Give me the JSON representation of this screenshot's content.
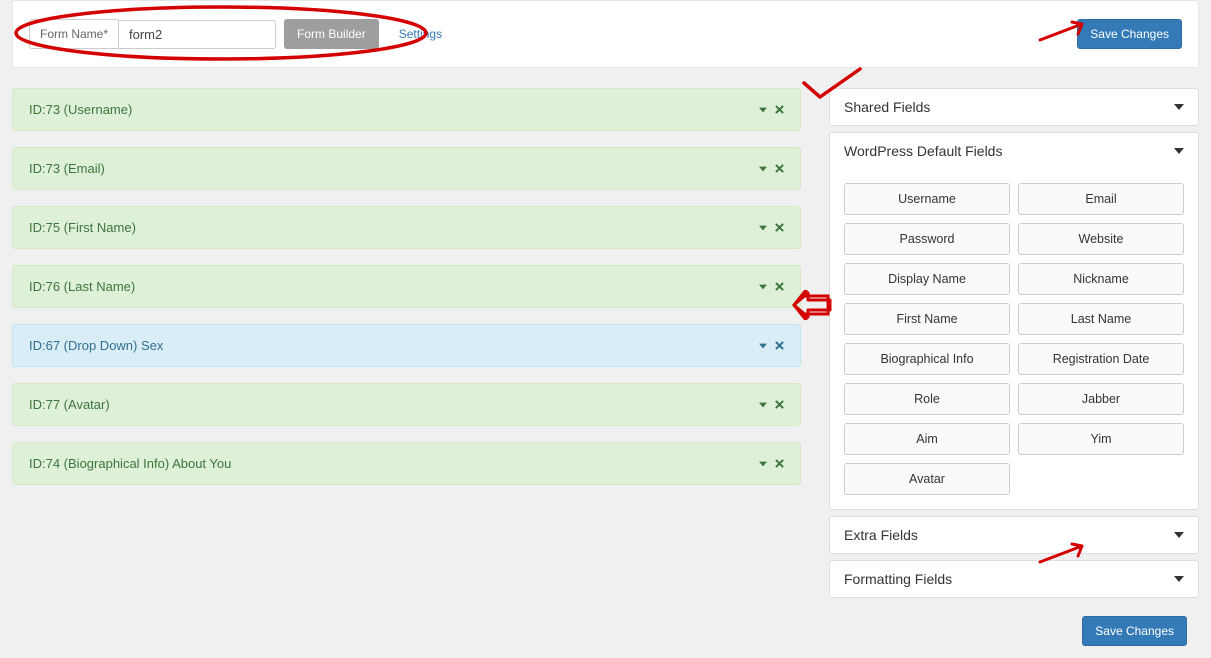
{
  "topbar": {
    "form_name_label": "Form Name*",
    "form_name_value": "form2",
    "form_builder_label": "Form Builder",
    "settings_label": "Settings",
    "save_label": "Save Changes"
  },
  "fields": [
    {
      "label": "ID:73 (Username)",
      "style": "green"
    },
    {
      "label": "ID:73 (Email)",
      "style": "green"
    },
    {
      "label": "ID:75 (First Name)",
      "style": "green"
    },
    {
      "label": "ID:76 (Last Name)",
      "style": "green"
    },
    {
      "label": "ID:67 (Drop Down) Sex",
      "style": "blue"
    },
    {
      "label": "ID:77 (Avatar)",
      "style": "green"
    },
    {
      "label": "ID:74 (Biographical Info) About You",
      "style": "green"
    }
  ],
  "sidebar": {
    "panels": {
      "shared": {
        "title": "Shared Fields",
        "expanded": false
      },
      "wp_default": {
        "title": "WordPress Default Fields",
        "expanded": true,
        "items": [
          "Username",
          "Email",
          "Password",
          "Website",
          "Display Name",
          "Nickname",
          "First Name",
          "Last Name",
          "Biographical Info",
          "Registration Date",
          "Role",
          "Jabber",
          "Aim",
          "Yim",
          "Avatar"
        ]
      },
      "extra": {
        "title": "Extra Fields",
        "expanded": false
      },
      "formatting": {
        "title": "Formatting Fields",
        "expanded": false
      }
    }
  },
  "bottom": {
    "save_label": "Save Changes"
  }
}
